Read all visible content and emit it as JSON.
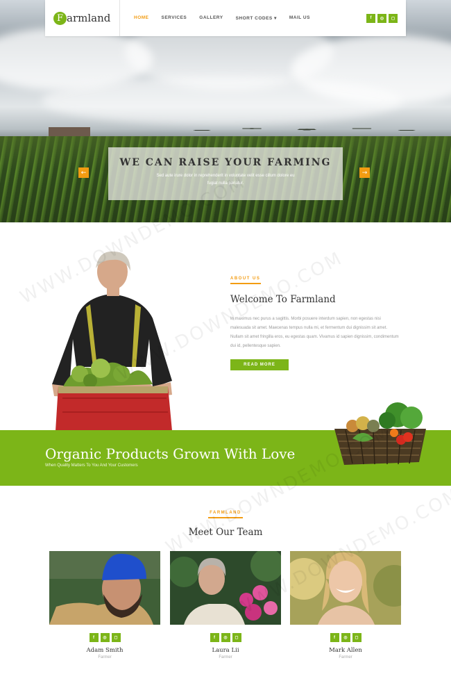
{
  "brand": {
    "badge_letter": "F",
    "name": "armland",
    "accent": "#7cb518",
    "highlight": "#f39c12"
  },
  "nav": {
    "items": [
      {
        "label": "HOME",
        "active": true
      },
      {
        "label": "SERVICES"
      },
      {
        "label": "GALLERY"
      },
      {
        "label": "SHORT CODES ▾"
      },
      {
        "label": "MAIL US"
      }
    ],
    "social_icons": [
      "facebook-icon",
      "dribbble-icon",
      "instagram-icon"
    ]
  },
  "hero": {
    "title": "WE CAN RAISE YOUR FARMING",
    "subtitle": "Sed aute irure dolor in reprehenderit in voluptate velit esse cillum dolore eu fugiat nulla pariatur.",
    "prev_glyph": "←",
    "next_glyph": "→"
  },
  "about": {
    "eyebrow": "ABOUT US",
    "title": "Welcome To Farmland",
    "body": "In maximus nec purus a sagittis. Morbi posuere interdum sapien, non egestas nisi malesuada sit amet. Maecenas tempus nulla mi, et fermentum dui dignissim sit amet. Nullam sit amet fringilla eros, eu egestas quam. Vivamus id sapien dignissim, condimentum dui id, pellentesque sapien.",
    "button": "READ MORE"
  },
  "banner": {
    "title": "Organic Products Grown With Love",
    "subtitle": "When Quality Matters To You And Your Customers"
  },
  "team": {
    "eyebrow": "FARMLAND",
    "title": "Meet Our Team",
    "members": [
      {
        "name": "Adam Smith",
        "role": "Farmer"
      },
      {
        "name": "Laura Lii",
        "role": "Farmer"
      },
      {
        "name": "Mark Allen",
        "role": "Farmer"
      }
    ]
  },
  "icon_glyphs": {
    "facebook": "f",
    "dribbble": "◎",
    "instagram": "◻"
  },
  "watermark": "WWW.DOWNDEMO.COM"
}
